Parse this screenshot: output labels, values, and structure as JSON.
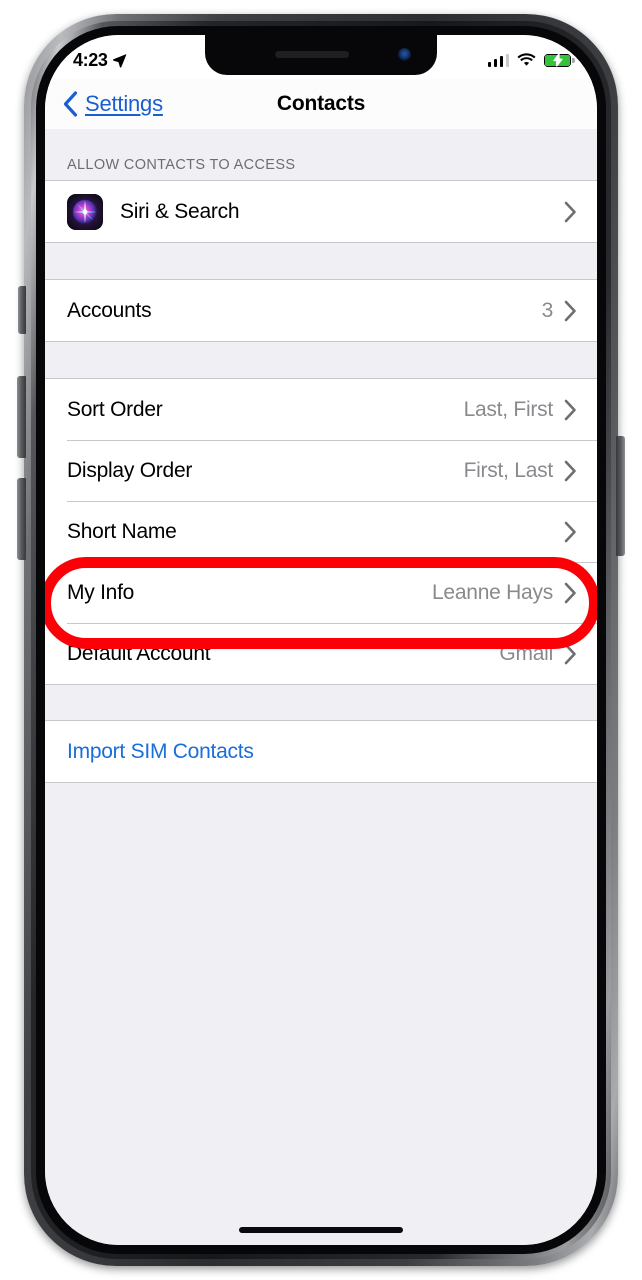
{
  "status_bar": {
    "time": "4:23",
    "location_icon": "location-arrow-icon",
    "signal_icon": "cellular-signal-icon",
    "signal_bars_filled": 3,
    "signal_bars_total": 4,
    "wifi_icon": "wifi-icon",
    "battery_icon": "battery-charging-icon",
    "battery_charging": true,
    "battery_color": "#36c33c"
  },
  "nav_bar": {
    "back_label": "Settings",
    "back_icon": "chevron-left-icon",
    "title": "Contacts",
    "link_color": "#1a5fd0"
  },
  "sections": [
    {
      "header": "ALLOW CONTACTS TO ACCESS",
      "rows": [
        {
          "label": "Siri & Search",
          "value": "",
          "icon": "siri-icon",
          "chevron": true
        }
      ]
    },
    {
      "header": "",
      "rows": [
        {
          "label": "Accounts",
          "value": "3",
          "icon": "",
          "chevron": true
        }
      ]
    },
    {
      "header": "",
      "rows": [
        {
          "label": "Sort Order",
          "value": "Last, First",
          "icon": "",
          "chevron": true,
          "highlighted": true
        },
        {
          "label": "Display Order",
          "value": "First, Last",
          "icon": "",
          "chevron": true
        },
        {
          "label": "Short Name",
          "value": "",
          "icon": "",
          "chevron": true
        },
        {
          "label": "My Info",
          "value": "Leanne Hays",
          "icon": "",
          "chevron": true
        },
        {
          "label": "Default Account",
          "value": "Gmail",
          "icon": "",
          "chevron": true
        }
      ]
    },
    {
      "header": "",
      "rows": [
        {
          "label": "Import SIM Contacts",
          "value": "",
          "icon": "",
          "chevron": false,
          "is_link": true
        }
      ]
    }
  ],
  "annotation": {
    "target": "Sort Order",
    "shape": "rounded-rectangle-outline",
    "color": "#fb0007"
  },
  "home_indicator": "home-indicator-bar"
}
